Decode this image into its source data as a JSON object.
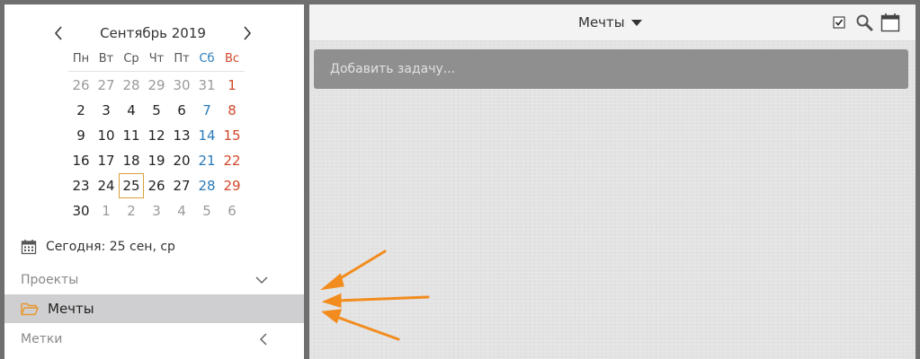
{
  "calendar": {
    "title": "Сентябрь 2019",
    "weekdays": [
      "Пн",
      "Вт",
      "Ср",
      "Чт",
      "Пт",
      "Сб",
      "Вс"
    ],
    "weeks": [
      [
        "26",
        "27",
        "28",
        "29",
        "30",
        "31",
        "1"
      ],
      [
        "2",
        "3",
        "4",
        "5",
        "6",
        "7",
        "8"
      ],
      [
        "9",
        "10",
        "11",
        "12",
        "13",
        "14",
        "15"
      ],
      [
        "16",
        "17",
        "18",
        "19",
        "20",
        "21",
        "22"
      ],
      [
        "23",
        "24",
        "25",
        "26",
        "27",
        "28",
        "29"
      ],
      [
        "30",
        "1",
        "2",
        "3",
        "4",
        "5",
        "6"
      ]
    ],
    "selected_day": "25"
  },
  "sidebar": {
    "today_label": "Сегодня: 25 сен, ср",
    "projects_label": "Проекты",
    "project_items": [
      {
        "label": "Мечты"
      }
    ],
    "tags_label": "Метки"
  },
  "main": {
    "project_title": "Мечты",
    "add_task_placeholder": "Добавить задачу..."
  },
  "colors": {
    "accent_arrow": "#f28c1e",
    "folder": "#e8962a",
    "today_border": "#d9a13a",
    "saturday": "#2a7ab8",
    "sunday": "#d0482a"
  },
  "icons": [
    "chevron-left-icon",
    "chevron-right-icon",
    "calendar-icon",
    "chevron-down-icon",
    "folder-open-icon",
    "chevron-left-icon",
    "caret-down-icon",
    "checkbox-icon",
    "search-icon",
    "calendar-icon",
    "annotation-arrow"
  ]
}
